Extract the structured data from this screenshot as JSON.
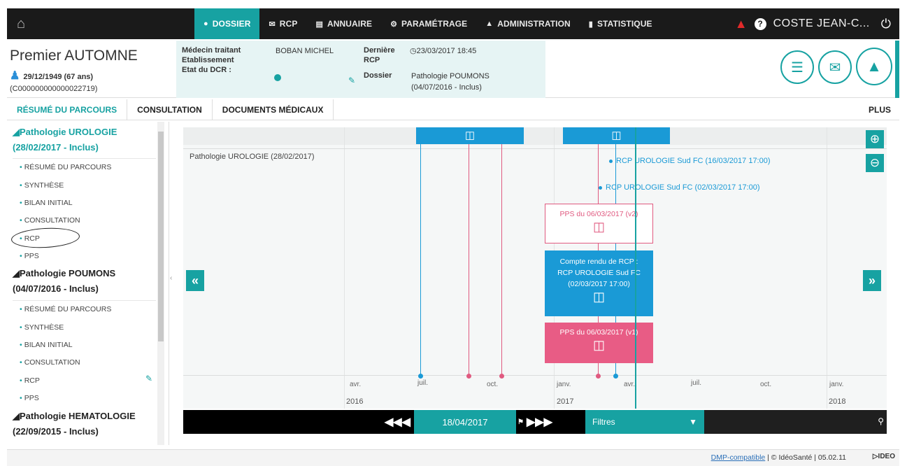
{
  "nav": {
    "items": [
      {
        "label": "DOSSIER",
        "icon": "user-icon",
        "glyph": "♟",
        "active": true
      },
      {
        "label": "RCP",
        "icon": "chat-icon",
        "glyph": "✉",
        "active": false
      },
      {
        "label": "ANNUAIRE",
        "icon": "book-icon",
        "glyph": "▤",
        "active": false
      },
      {
        "label": "PARAMÉTRAGE",
        "icon": "gear-icon",
        "glyph": "⚙",
        "active": false
      },
      {
        "label": "ADMINISTRATION",
        "icon": "lock-icon",
        "glyph": "▲",
        "active": false
      },
      {
        "label": "STATISTIQUE",
        "icon": "bar-chart-icon",
        "glyph": "▐",
        "active": false
      }
    ],
    "username": "COSTE JEAN-C..."
  },
  "patient": {
    "name": "Premier AUTOMNE",
    "dob": "29/12/1949 (67 ans)",
    "id": "(C000000000000022719)",
    "medecin_label": "Médecin traitant",
    "medecin_value": "BOBAN MICHEL",
    "etablissement_label": "Etablissement",
    "etat_label": "Etat du DCR :",
    "derniere_label": "Dernière",
    "rcp_label": "RCP",
    "derniere_value": "23/03/2017 18:45",
    "dossier_label": "Dossier",
    "dossier_value_1": "Pathologie POUMONS",
    "dossier_value_2": "(04/07/2016 - Inclus)"
  },
  "tabs": [
    {
      "label": "RÉSUMÉ DU PARCOURS",
      "active": true
    },
    {
      "label": "CONSULTATION",
      "active": false
    },
    {
      "label": "DOCUMENTS MÉDICAUX",
      "active": false
    }
  ],
  "tab_plus": "PLUS",
  "sidebar": {
    "groups": [
      {
        "title1": "Pathologie UROLOGIE",
        "title2": "(28/02/2017 - Inclus)",
        "items": [
          "RÉSUMÉ DU PARCOURS",
          "SYNTHÈSE",
          "BILAN INITIAL",
          "CONSULTATION",
          "RCP",
          "PPS"
        ]
      },
      {
        "title1": "Pathologie POUMONS",
        "title2": "(04/07/2016 - Inclus)",
        "items": [
          "RÉSUMÉ DU PARCOURS",
          "SYNTHÈSE",
          "BILAN INITIAL",
          "CONSULTATION",
          "RCP",
          "PPS"
        ]
      },
      {
        "title1": "Pathologie HEMATOLOGIE",
        "title2": "(22/09/2015 - Inclus)",
        "items": []
      }
    ]
  },
  "timeline": {
    "pathology_label": "Pathologie UROLOGIE (28/02/2017)",
    "rcp_events": [
      "RCP UROLOGIE Sud FC (16/03/2017 17:00)",
      "RCP UROLOGIE Sud FC (02/03/2017 17:00)"
    ],
    "card_pps_v2": "PPS du 06/03/2017 (v2)",
    "card_compte_rendu": [
      "Compte rendu de RCP :",
      "RCP UROLOGIE Sud FC",
      "(02/03/2017 17:00)"
    ],
    "card_pps_v1": "PPS du 06/03/2017 (v1)",
    "axis_months": [
      "avr.",
      "juil.",
      "oct.",
      "janv.",
      "avr.",
      "juil.",
      "oct.",
      "janv."
    ],
    "axis_years": [
      "2016",
      "2017",
      "2018"
    ],
    "colors": {
      "teal": "#17a2a2",
      "blue": "#1a9ad6",
      "pink": "#e05a80"
    }
  },
  "controls": {
    "date": "18/04/2017",
    "filter_label": "Filtres"
  },
  "footer": {
    "dmp": "DMP-compatible",
    "rest": " | © IdéoSanté | 05.02.11",
    "logo": "IDEO"
  }
}
